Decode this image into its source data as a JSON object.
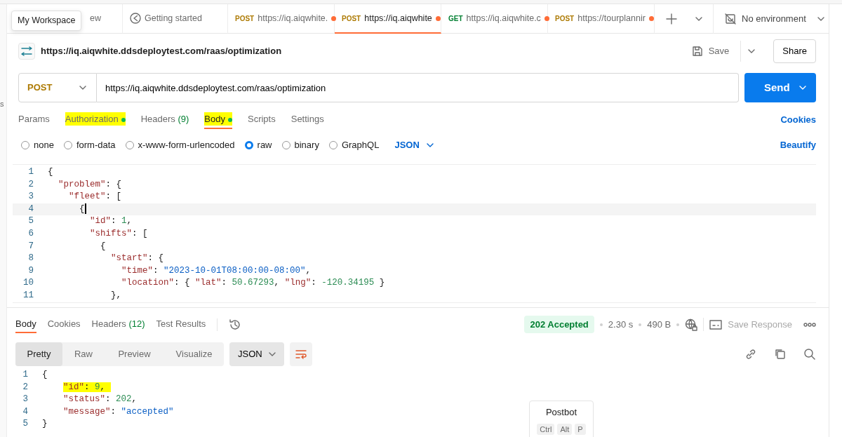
{
  "sidebar_fragment": "s",
  "tooltip": "My Workspace",
  "tabs": [
    {
      "kind": "plain",
      "label": "ew",
      "selected": false
    },
    {
      "kind": "guide",
      "label": "Getting started",
      "selected": false
    },
    {
      "kind": "request",
      "method": "POST",
      "label": "https://iq.aiqwhite.",
      "unsaved": true,
      "selected": false
    },
    {
      "kind": "request",
      "method": "POST",
      "label": "https://iq.aiqwhite",
      "unsaved": true,
      "selected": true
    },
    {
      "kind": "request",
      "method": "GET",
      "label": "https://iq.aiqwhite.c",
      "unsaved": true,
      "selected": false
    },
    {
      "kind": "request",
      "method": "POST",
      "label": "https://tourplannir",
      "unsaved": true,
      "selected": false
    }
  ],
  "environment": "No environment",
  "request": {
    "title": "https://iq.aiqwhite.ddsdeploytest.com/raas/optimization",
    "save": "Save",
    "share": "Share",
    "method": "POST",
    "url": "https://iq.aiqwhite.ddsdeploytest.com/raas/optimization",
    "send": "Send"
  },
  "request_tabs": [
    {
      "label": "Params",
      "dot": false,
      "highlighted": false,
      "selected": false
    },
    {
      "label": "Authorization",
      "dot": true,
      "highlighted": true,
      "selected": false
    },
    {
      "label": "Headers",
      "count": "(9)",
      "dot": false,
      "highlighted": false,
      "selected": false
    },
    {
      "label": "Body",
      "dot": true,
      "highlighted": true,
      "selected": true
    },
    {
      "label": "Scripts",
      "dot": false,
      "highlighted": false,
      "selected": false
    },
    {
      "label": "Settings",
      "dot": false,
      "highlighted": false,
      "selected": false
    }
  ],
  "cookies_link": "Cookies",
  "body_types": [
    {
      "label": "none",
      "selected": false
    },
    {
      "label": "form-data",
      "selected": false
    },
    {
      "label": "x-www-form-urlencoded",
      "selected": false
    },
    {
      "label": "raw",
      "selected": true
    },
    {
      "label": "binary",
      "selected": false
    },
    {
      "label": "GraphQL",
      "selected": false
    }
  ],
  "body_format": "JSON",
  "beautify": "Beautify",
  "editor_lines": [
    {
      "number": "1",
      "text": "{",
      "current": false
    },
    {
      "number": "2",
      "text": "  \"problem\": {",
      "current": false
    },
    {
      "number": "3",
      "text": "    \"fleet\": [",
      "current": false
    },
    {
      "number": "4",
      "text": "      {",
      "current": true
    },
    {
      "number": "5",
      "text": "        \"id\": 1,",
      "current": false
    },
    {
      "number": "6",
      "text": "        \"shifts\": [",
      "current": false
    },
    {
      "number": "7",
      "text": "          {",
      "current": false
    },
    {
      "number": "8",
      "text": "            \"start\": {",
      "current": false
    },
    {
      "number": "9",
      "text": "              \"time\": \"2023-10-01T08:00:00-08:00\",",
      "current": false
    },
    {
      "number": "10",
      "text": "              \"location\": { \"lat\": 50.67293, \"lng\": -120.34195 }",
      "current": false
    },
    {
      "number": "11",
      "text": "            },",
      "current": false
    }
  ],
  "response_tabs": [
    {
      "label": "Body",
      "selected": true
    },
    {
      "label": "Cookies",
      "selected": false
    },
    {
      "label": "Headers",
      "count": "(12)",
      "selected": false
    },
    {
      "label": "Test Results",
      "selected": false
    }
  ],
  "response_meta": {
    "status": "202 Accepted",
    "time": "2.30 s",
    "size": "490 B",
    "save_response": "Save Response"
  },
  "view_modes": [
    {
      "label": "Pretty",
      "selected": true
    },
    {
      "label": "Raw",
      "selected": false
    },
    {
      "label": "Preview",
      "selected": false
    },
    {
      "label": "Visualize",
      "selected": false
    }
  ],
  "response_format": "JSON",
  "response_lines": [
    {
      "number": "1",
      "text": "{",
      "highlighted": false
    },
    {
      "number": "2",
      "text": "    \"id\": 9,",
      "highlighted": true
    },
    {
      "number": "3",
      "text": "    \"status\": 202,",
      "highlighted": false
    },
    {
      "number": "4",
      "text": "    \"message\": \"accepted\"",
      "highlighted": false
    },
    {
      "number": "5",
      "text": "}",
      "highlighted": false
    }
  ],
  "postbot": {
    "title": "Postbot",
    "keys": [
      "Ctrl",
      "Alt",
      "P"
    ]
  }
}
